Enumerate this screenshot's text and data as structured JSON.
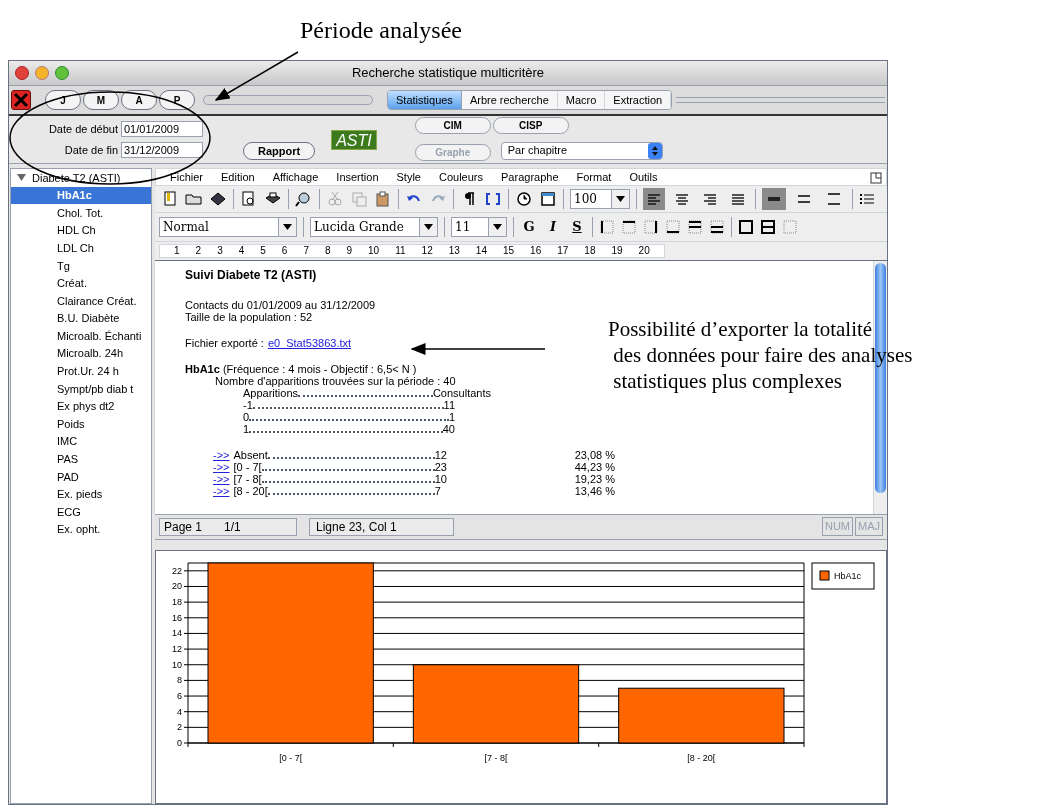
{
  "annotations": [
    {
      "kind": "period",
      "text": "Période analysée"
    },
    {
      "kind": "export",
      "text": "Possibilité d’exporter la totalité\n des données pour faire des analyses\n statistiques plus complexes"
    }
  ],
  "window": {
    "title": "Recherche statistique multicritère"
  },
  "period_buttons": [
    "J",
    "M",
    "A",
    "P"
  ],
  "tabs": [
    {
      "label": "Statistiques",
      "selected": true
    },
    {
      "label": "Arbre recherche",
      "selected": false
    },
    {
      "label": "Macro",
      "selected": false
    },
    {
      "label": "Extraction",
      "selected": false
    }
  ],
  "dates": [
    {
      "label": "Date de début",
      "value": "01/01/2009"
    },
    {
      "label": "Date de fin",
      "value": "31/12/2009"
    }
  ],
  "rapport_button": "Rapport",
  "logo": "ASTI",
  "buttons": [
    {
      "label": "CIM",
      "disabled": false
    },
    {
      "label": "CISP",
      "disabled": false
    },
    {
      "label": "Graphe",
      "disabled": true
    }
  ],
  "grouping_select": "Par chapitre",
  "sidebar": {
    "tree": [
      {
        "label": "Diabete T2 (ASTI)",
        "expanded": true,
        "selected": false,
        "children": [
          {
            "label": "HbA1c",
            "selected": true
          },
          {
            "label": "Chol. Tot.",
            "selected": false
          },
          {
            "label": "HDL Ch",
            "selected": false
          },
          {
            "label": "LDL Ch",
            "selected": false
          },
          {
            "label": "Tg",
            "selected": false
          },
          {
            "label": "Créat.",
            "selected": false
          },
          {
            "label": "Clairance Créat.",
            "selected": false
          },
          {
            "label": "B.U. Diabète",
            "selected": false
          },
          {
            "label": "Microalb. Échanti",
            "selected": false
          },
          {
            "label": "Microalb. 24h",
            "selected": false
          },
          {
            "label": "Prot.Ur. 24 h",
            "selected": false
          },
          {
            "label": "Sympt/pb diab t",
            "selected": false
          },
          {
            "label": "Ex phys dt2",
            "selected": false
          },
          {
            "label": "Poids",
            "selected": false
          },
          {
            "label": "IMC",
            "selected": false
          },
          {
            "label": "PAS",
            "selected": false
          },
          {
            "label": "PAD",
            "selected": false
          },
          {
            "label": "Ex. pieds",
            "selected": false
          },
          {
            "label": "ECG",
            "selected": false
          },
          {
            "label": "Ex. opht.",
            "selected": false
          }
        ]
      }
    ]
  },
  "editor": {
    "menu": [
      "Fichier",
      "Edition",
      "Affichage",
      "Insertion",
      "Style",
      "Couleurs",
      "Paragraphe",
      "Format",
      "Outils"
    ],
    "zoom": "100",
    "alignment_buttons": [
      {
        "selected": true
      },
      {
        "selected": false
      },
      {
        "selected": false
      },
      {
        "selected": false
      }
    ],
    "spacing_buttons": [
      {
        "selected": true
      },
      {
        "selected": false
      },
      {
        "selected": false
      }
    ],
    "style_select": "Normal",
    "font_select": "Lucida Grande",
    "size_select": "11",
    "format_buttons": [
      "G",
      "I",
      "S"
    ],
    "ruler": [
      "1",
      "2",
      "3",
      "4",
      "5",
      "6",
      "7",
      "8",
      "9",
      "10",
      "11",
      "12",
      "13",
      "14",
      "15",
      "16",
      "17",
      "18",
      "19",
      "20"
    ]
  },
  "document": {
    "title": "Suivi Diabete T2 (ASTI)",
    "lines": [
      "Contacts du 01/01/2009 au 31/12/2009",
      "Taille de la population : 52"
    ],
    "export_label": "Fichier exporté :",
    "export_link": "e0_Stat53863.txt",
    "section": "**HbA1c** (Fréquence : 4 mois - Objectif : 6,5< N )",
    "count_line": "Nombre d'apparitions trouvées sur la période : 40",
    "table_header": [
      "Apparitions",
      "Consultants"
    ],
    "table_rows": [
      [
        "-1",
        "11"
      ],
      [
        "0",
        "1"
      ],
      [
        "1",
        "40"
      ]
    ],
    "classes": [
      {
        "link": "->>",
        "label": "Absent",
        "count": "12",
        "percent": "23,08 %"
      },
      {
        "link": "->>",
        "label": "[0 - 7[",
        "count": "23",
        "percent": "44,23 %"
      },
      {
        "link": "->>",
        "label": "[7 - 8[",
        "count": "10",
        "percent": "19,23 %"
      },
      {
        "link": "->>",
        "label": "[8 - 20[",
        "count": "7",
        "percent": "13,46 %"
      }
    ]
  },
  "status_bar": {
    "page": "Page 1",
    "pages": "1/1",
    "position": "Ligne 23, Col 1",
    "indicators": [
      {
        "label": "NUM",
        "on": false
      },
      {
        "label": "MAJ",
        "on": false
      }
    ]
  },
  "chart": {
    "chart_data": {
      "type": "bar",
      "categories": [
        "[0 - 7[",
        "[7 - 8[",
        "[8 - 20["
      ],
      "series": [
        {
          "name": "HbA1c",
          "color": "#ff6600",
          "values": [
            23,
            10,
            7
          ]
        }
      ],
      "grid": true,
      "ylim": [
        0,
        23
      ],
      "yticks": [
        0,
        2,
        4,
        6,
        8,
        10,
        12,
        14,
        16,
        18,
        20,
        22
      ]
    }
  }
}
